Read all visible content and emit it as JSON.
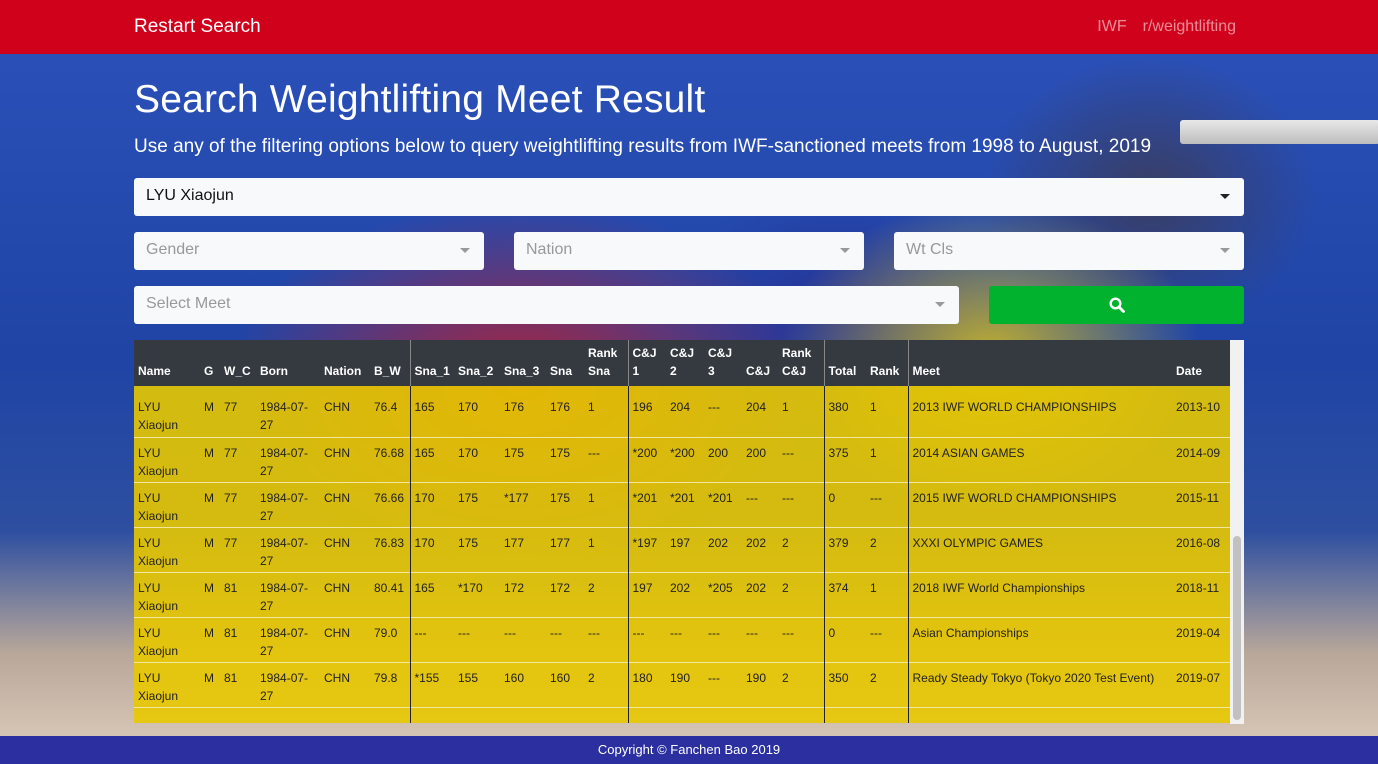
{
  "navbar": {
    "brand": "Restart Search",
    "links": [
      "IWF",
      "r/weightlifting"
    ]
  },
  "header": {
    "title": "Search Weightlifting Meet Result",
    "subtitle": "Use any of the filtering options below to query weightlifting results from IWF-sanctioned meets from 1998 to August, 2019"
  },
  "filters": {
    "athlete": "LYU Xiaojun",
    "gender_placeholder": "Gender",
    "nation_placeholder": "Nation",
    "wtcls_placeholder": "Wt Cls",
    "meet_placeholder": "Select Meet",
    "search_icon": "search-icon"
  },
  "colors": {
    "navbar": "#d0021b",
    "search_button": "#00b22d",
    "table_header": "#343a40",
    "table_row": "#e8c800",
    "footer": "#2b2fa0"
  },
  "table": {
    "headers": [
      [
        "Name"
      ],
      [
        "G"
      ],
      [
        "W_C"
      ],
      [
        "Born"
      ],
      [
        "Nation"
      ],
      [
        "B_W"
      ],
      [
        "Sna_1"
      ],
      [
        "Sna_2"
      ],
      [
        "Sna_3"
      ],
      [
        "Sna"
      ],
      [
        "Rank",
        "Sna"
      ],
      [
        "C&J",
        "1"
      ],
      [
        "C&J",
        "2"
      ],
      [
        "C&J",
        "3"
      ],
      [
        "C&J"
      ],
      [
        "Rank",
        "C&J"
      ],
      [
        "Total"
      ],
      [
        "Rank"
      ],
      [
        "Meet"
      ],
      [
        "Date"
      ]
    ],
    "rows": [
      [
        "LYU Xiaojun",
        "M",
        "77",
        "1984-07-27",
        "CHN",
        "76.4",
        "165",
        "170",
        "176",
        "176",
        "1",
        "196",
        "204",
        "---",
        "204",
        "1",
        "380",
        "1",
        "2013 IWF WORLD CHAMPIONSHIPS",
        "2013-10"
      ],
      [
        "LYU Xiaojun",
        "M",
        "77",
        "1984-07-27",
        "CHN",
        "76.68",
        "165",
        "170",
        "175",
        "175",
        "---",
        "*200",
        "*200",
        "200",
        "200",
        "---",
        "375",
        "1",
        "2014 ASIAN GAMES",
        "2014-09"
      ],
      [
        "LYU Xiaojun",
        "M",
        "77",
        "1984-07-27",
        "CHN",
        "76.66",
        "170",
        "175",
        "*177",
        "175",
        "1",
        "*201",
        "*201",
        "*201",
        "---",
        "---",
        "0",
        "---",
        "2015 IWF WORLD CHAMPIONSHIPS",
        "2015-11"
      ],
      [
        "LYU Xiaojun",
        "M",
        "77",
        "1984-07-27",
        "CHN",
        "76.83",
        "170",
        "175",
        "177",
        "177",
        "1",
        "*197",
        "197",
        "202",
        "202",
        "2",
        "379",
        "2",
        "XXXI OLYMPIC GAMES",
        "2016-08"
      ],
      [
        "LYU Xiaojun",
        "M",
        "81",
        "1984-07-27",
        "CHN",
        "80.41",
        "165",
        "*170",
        "172",
        "172",
        "2",
        "197",
        "202",
        "*205",
        "202",
        "2",
        "374",
        "1",
        "2018 IWF World Championships",
        "2018-11"
      ],
      [
        "LYU Xiaojun",
        "M",
        "81",
        "1984-07-27",
        "CHN",
        "79.0",
        "---",
        "---",
        "---",
        "---",
        "---",
        "---",
        "---",
        "---",
        "---",
        "---",
        "0",
        "---",
        "Asian Championships",
        "2019-04"
      ],
      [
        "LYU Xiaojun",
        "M",
        "81",
        "1984-07-27",
        "CHN",
        "79.8",
        "*155",
        "155",
        "160",
        "160",
        "2",
        "180",
        "190",
        "---",
        "190",
        "2",
        "350",
        "2",
        "Ready Steady Tokyo (Tokyo 2020 Test Event)",
        "2019-07"
      ]
    ]
  },
  "footer": {
    "text": "Copyright © Fanchen Bao 2019"
  }
}
